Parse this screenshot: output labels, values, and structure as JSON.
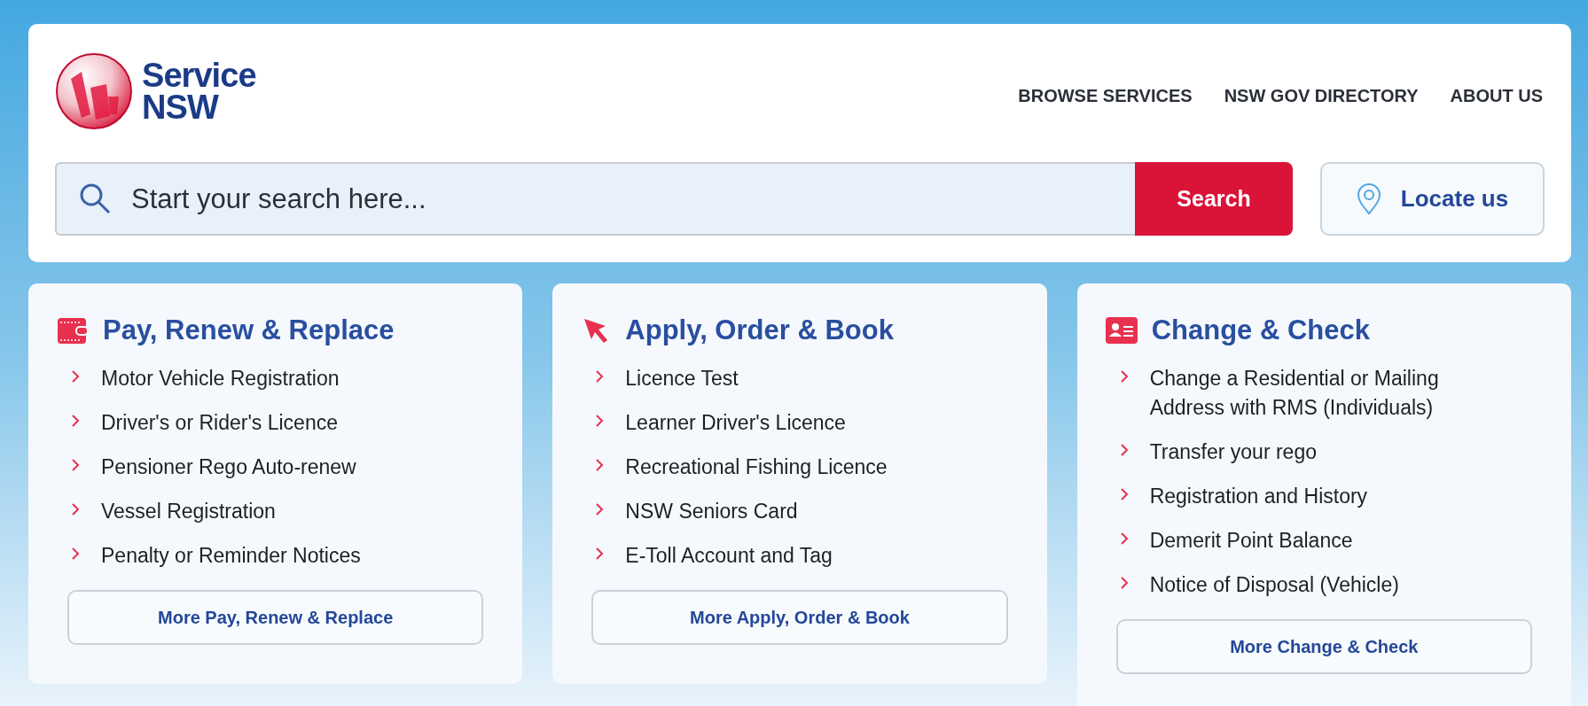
{
  "logo": {
    "line_1": "Service",
    "line_2": "NSW"
  },
  "nav": [
    {
      "label": "BROWSE SERVICES"
    },
    {
      "label": "NSW GOV DIRECTORY"
    },
    {
      "label": "ABOUT US"
    }
  ],
  "search": {
    "placeholder": "Start your search here...",
    "button": "Search"
  },
  "locate_button": "Locate us",
  "cards": [
    {
      "kind": "wallet",
      "title": "Pay, Renew & Replace",
      "items": [
        "Motor Vehicle Registration",
        "Driver's or Rider's Licence",
        "Pensioner Rego Auto-renew",
        "Vessel Registration",
        "Penalty or Reminder Notices"
      ],
      "more": "More Pay, Renew & Replace"
    },
    {
      "kind": "cursor",
      "title": "Apply, Order & Book",
      "items": [
        "Licence Test",
        "Learner Driver's Licence",
        "Recreational Fishing Licence",
        "NSW Seniors Card",
        "E-Toll Account and Tag"
      ],
      "more": "More Apply, Order & Book"
    },
    {
      "kind": "idcard",
      "title": "Change & Check",
      "items": [
        "Change a Residential or Mailing Address with RMS (Individuals)",
        "Transfer your rego",
        "Registration and History",
        "Demerit Point Balance",
        "Notice of Disposal (Vehicle)"
      ],
      "more": "More Change & Check"
    }
  ]
}
